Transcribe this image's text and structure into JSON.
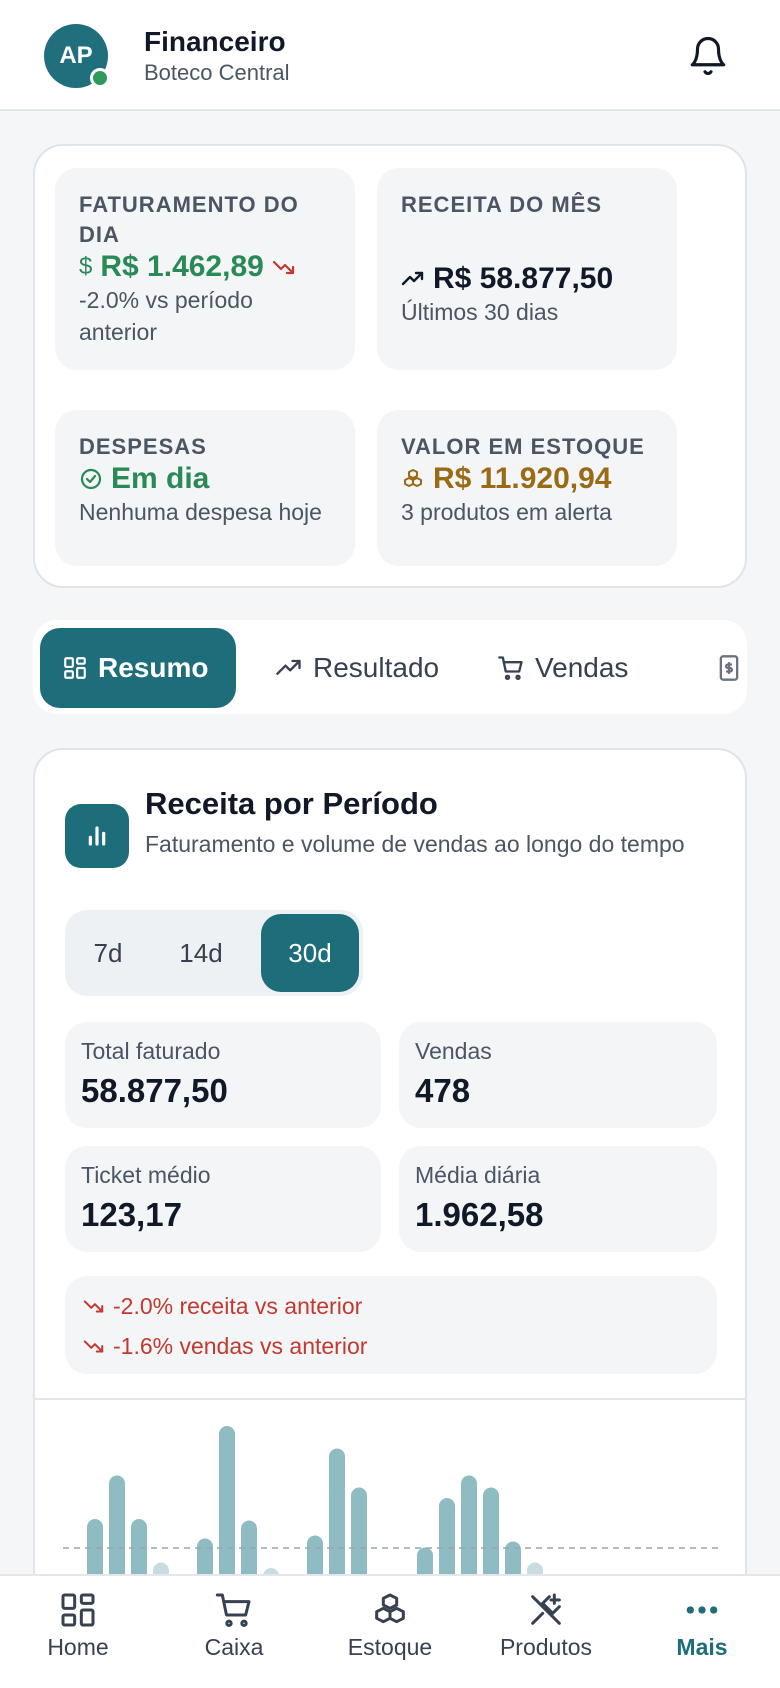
{
  "header": {
    "avatar_initials": "AP",
    "title": "Financeiro",
    "subtitle": "Boteco Central",
    "bell_icon": "bell-icon"
  },
  "kpis": {
    "faturamento": {
      "label": "FATURAMENTO DO DIA",
      "value": "R$ 1.462,89",
      "note": "-2.0% vs período anterior",
      "icon": "dollar-icon"
    },
    "receita": {
      "label": "RECEITA DO MÊS",
      "value": "R$ 58.877,50",
      "note": "Últimos 30 dias",
      "icon": "trend-up-icon"
    },
    "despesas": {
      "label": "DESPESAS",
      "value": "Em dia",
      "note": "Nenhuma despesa hoje",
      "icon": "check-circle-icon"
    },
    "estoque": {
      "label": "VALOR EM ESTOQUE",
      "value": "R$ 11.920,94",
      "note": "3 produtos em alerta",
      "icon": "boxes-icon"
    }
  },
  "tabs": [
    {
      "label": "Resumo",
      "icon": "grid-icon",
      "active": true
    },
    {
      "label": "Resultado",
      "icon": "trend-up-icon"
    },
    {
      "label": "Vendas",
      "icon": "cart-icon"
    },
    {
      "label": "",
      "icon": "receipt-icon"
    }
  ],
  "revenue": {
    "title": "Receita por Período",
    "subtitle": "Faturamento e volume de vendas ao longo do tempo",
    "periods": [
      "7d",
      "14d",
      "30d"
    ],
    "active_period": "30d",
    "stats": {
      "total_label": "Total faturado",
      "total_value": "58.877,50",
      "vendas_label": "Vendas",
      "vendas_value": "478",
      "ticket_label": "Ticket médio",
      "ticket_value": "123,17",
      "media_label": "Média diária",
      "media_value": "1.962,58"
    },
    "trend_receita": "-2.0% receita vs anterior",
    "trend_vendas": "-1.6% vendas vs anterior"
  },
  "chart_data": {
    "type": "bar",
    "title": "",
    "values": [
      0.38,
      0.67,
      0.38,
      0.09,
      0.0,
      0.25,
      1.0,
      0.37,
      0.04,
      0.0,
      0.27,
      0.85,
      0.59,
      0.0,
      0.0,
      0.19,
      0.52,
      0.67,
      0.59,
      0.23,
      0.09
    ],
    "reference_line": "average (dashed)"
  },
  "nav": [
    {
      "label": "Home",
      "icon": "home-grid-icon"
    },
    {
      "label": "Caixa",
      "icon": "cart-icon"
    },
    {
      "label": "Estoque",
      "icon": "boxes-icon"
    },
    {
      "label": "Produtos",
      "icon": "utensils-icon"
    },
    {
      "label": "Mais",
      "icon": "more-dots-icon",
      "active": true
    }
  ],
  "colors": {
    "primary": "#1e6d7a",
    "positive": "#2a8a56",
    "negative": "#c2392f",
    "stock": "#9a6a15"
  }
}
